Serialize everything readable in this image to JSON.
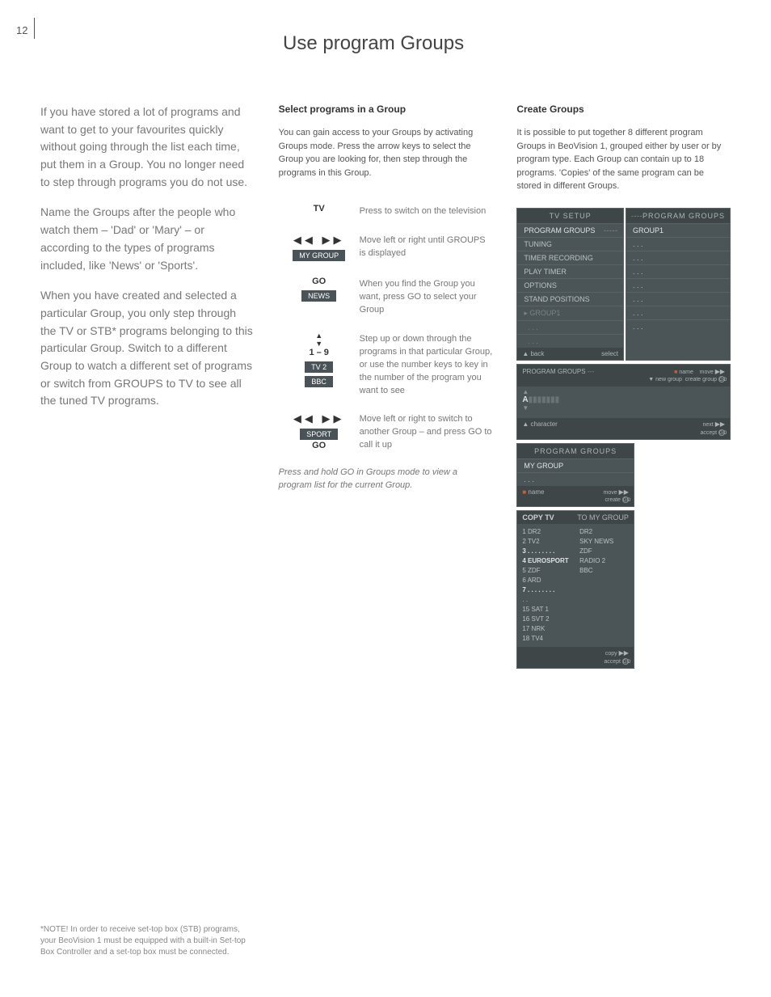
{
  "page_number": "12",
  "title": "Use program Groups",
  "intro": {
    "p1": "If you have stored a lot of programs and want to get to your favourites quickly without going through the list each time, put them in a Group. You no longer need to step through programs you do not use.",
    "p2": "Name the Groups after the people who watch them – 'Dad' or 'Mary' – or according to the types of programs included, like 'News' or 'Sports'.",
    "p3": "When you have created and selected a particular Group, you only step through the TV or STB* programs belonging to this particular Group. Switch to a different Group to watch a different set of programs or switch from GROUPS to TV to see all the tuned TV programs."
  },
  "select": {
    "title": "Select programs in a Group",
    "lead": "You can gain access to your Groups by activating Groups mode. Press the arrow keys to select the Group you are looking for, then step through the programs in this Group.",
    "steps": [
      {
        "key": "TV",
        "chip": "",
        "desc": "Press to switch on the television"
      },
      {
        "key": "◀◀   ▶▶",
        "chip": "MY GROUP",
        "desc": "Move left or right until GROUPS is displayed"
      },
      {
        "key": "GO",
        "chip": "NEWS",
        "desc": "When you find the Group you want, press GO to select your Group"
      },
      {
        "key": "▲\n▼\n1 – 9",
        "chip": "TV 2",
        "chip2": "BBC",
        "desc": "Step up or down through the programs in that particular Group, or use the number keys to key in the number of the program you want to see"
      },
      {
        "key": "◀◀   ▶▶",
        "chip": "SPORT",
        "key2": "GO",
        "desc": "Move left or right to switch to another Group – and press GO to call it up"
      }
    ],
    "note": "Press and hold GO in Groups mode to view a program list for the current Group."
  },
  "create": {
    "title": "Create Groups",
    "lead": "It is possible to put together 8 different program Groups in BeoVision 1, grouped either by user or by program type. Each Group can contain up to 18 programs. 'Copies' of the same program can be stored in different Groups."
  },
  "osd": {
    "tv_setup": "TV  SETUP",
    "program_groups": "PROGRAM  GROUPS",
    "tuning": "TUNING",
    "timer_recording": "TIMER  RECORDING",
    "play_timer": "PLAY  TIMER",
    "options": "OPTIONS",
    "stand_positions": "STAND  POSITIONS",
    "group1": "GROUP1",
    "group1_caps": "GROUP1",
    "back": "back",
    "select": "select",
    "name": "name",
    "new_group": "new group",
    "move": "move",
    "create_group": "create group",
    "character": "character",
    "next": "next",
    "accept": "accept",
    "my_group": "MY GROUP",
    "create": "create",
    "copy_tv": "COPY TV",
    "to_my_group": "TO MY GROUP",
    "copy": "copy",
    "A": "A",
    "left_list": [
      "1 DR2",
      "2 TV2",
      "3 . . . . . . . .",
      "4 EUROSPORT",
      "5 ZDF",
      "6 ARD",
      "7 . . . . . . . .",
      ". .",
      "15 SAT 1",
      "16 SVT 2",
      "17 NRK",
      "18 TV4"
    ],
    "right_list": [
      "DR2",
      "SKY NEWS",
      "ZDF",
      "RADIO 2",
      "BBC"
    ]
  },
  "footnote": "*NOTE! In order to receive set-top box (STB) programs, your BeoVision 1 must be equipped with a built-in Set-top Box Controller and a set-top box must be connected."
}
